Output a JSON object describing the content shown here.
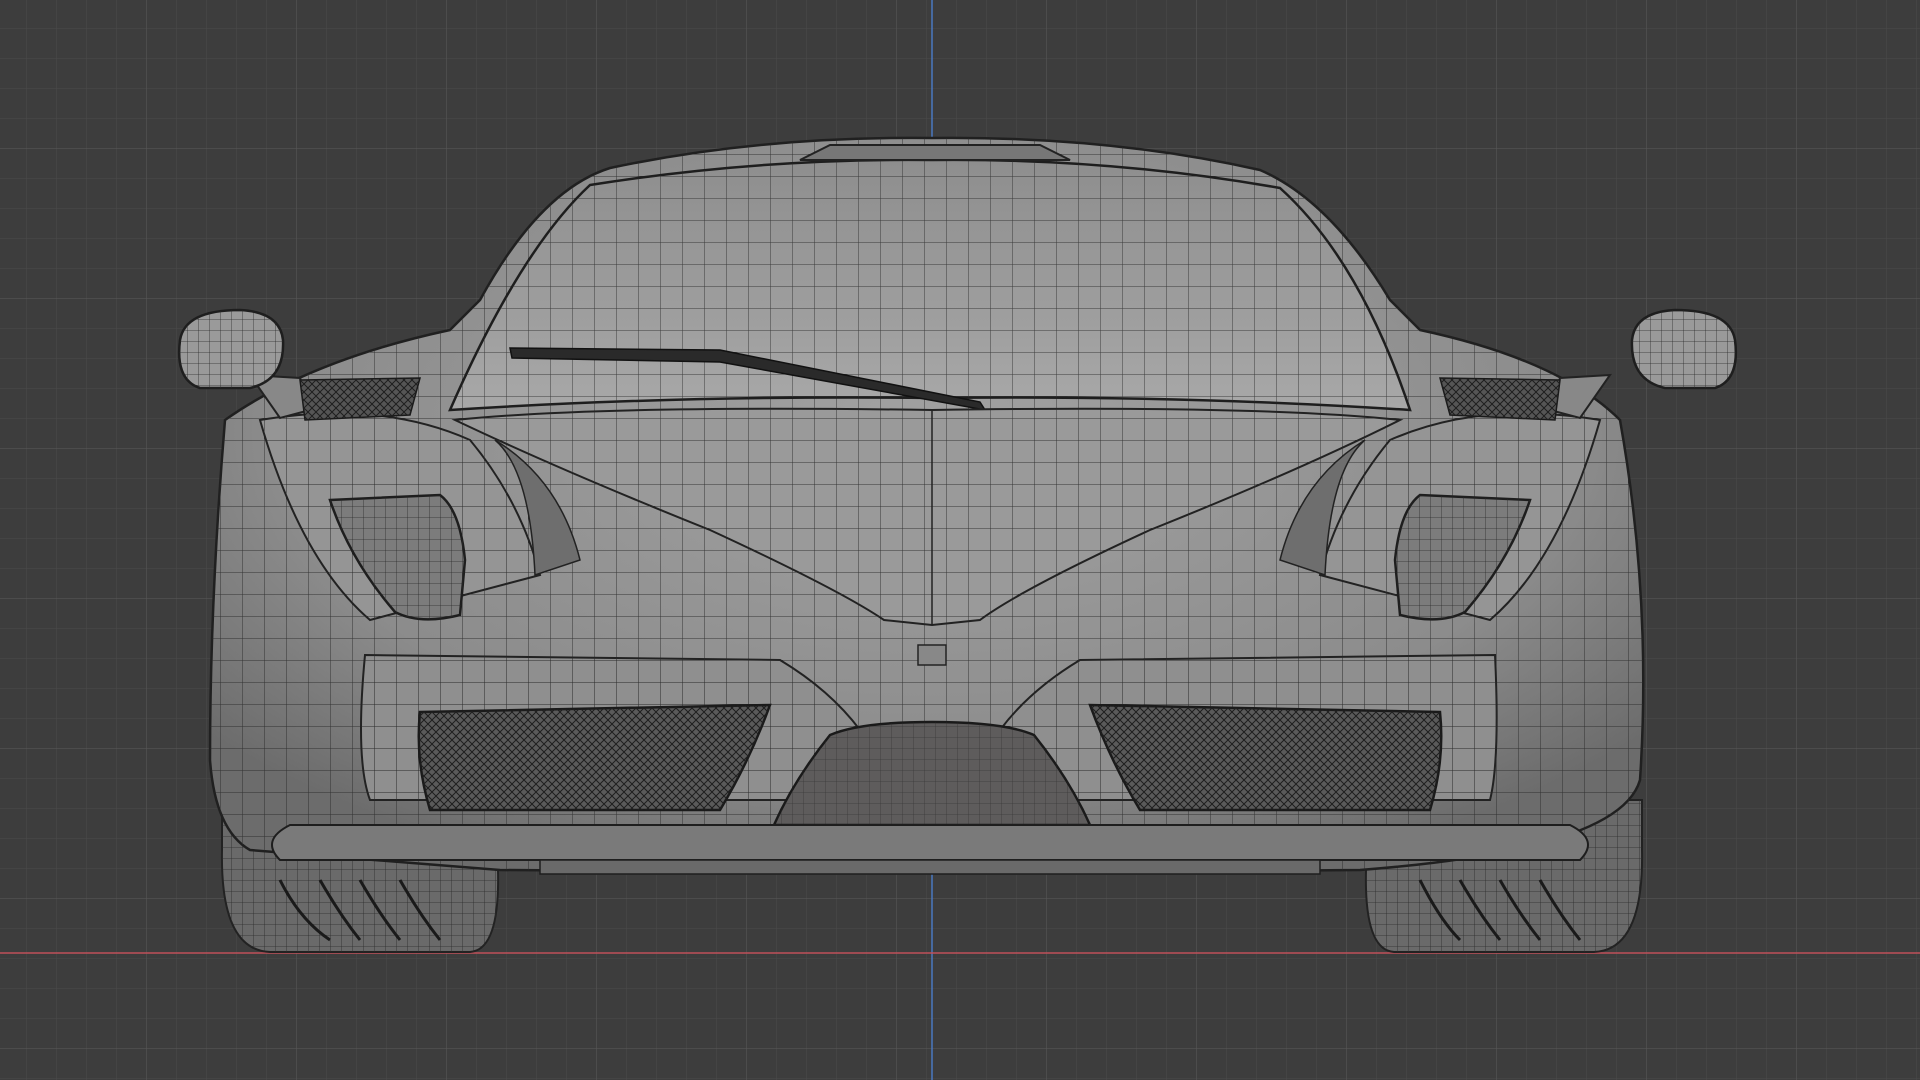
{
  "viewport": {
    "view": "front-orthographic",
    "shading": "solid-wireframe-overlay",
    "colors": {
      "background": "#3d3d3d",
      "grid_minor": "#4a4a4a",
      "grid_major": "#555555",
      "axis_x": "#c0505a",
      "axis_z": "#4a78c0",
      "mesh_fill": "#8a8a8a",
      "mesh_light": "#a3a3a3",
      "mesh_dark": "#5f5f5f",
      "wire": "#2a2a2a"
    }
  },
  "scene": {
    "object": "car-mesh",
    "parts": [
      "body",
      "windshield",
      "wiper",
      "hood",
      "left-mirror",
      "right-mirror",
      "left-headlight",
      "right-headlight",
      "left-intake",
      "right-intake",
      "center-intake",
      "front-splitter",
      "left-wheel",
      "right-wheel"
    ]
  }
}
